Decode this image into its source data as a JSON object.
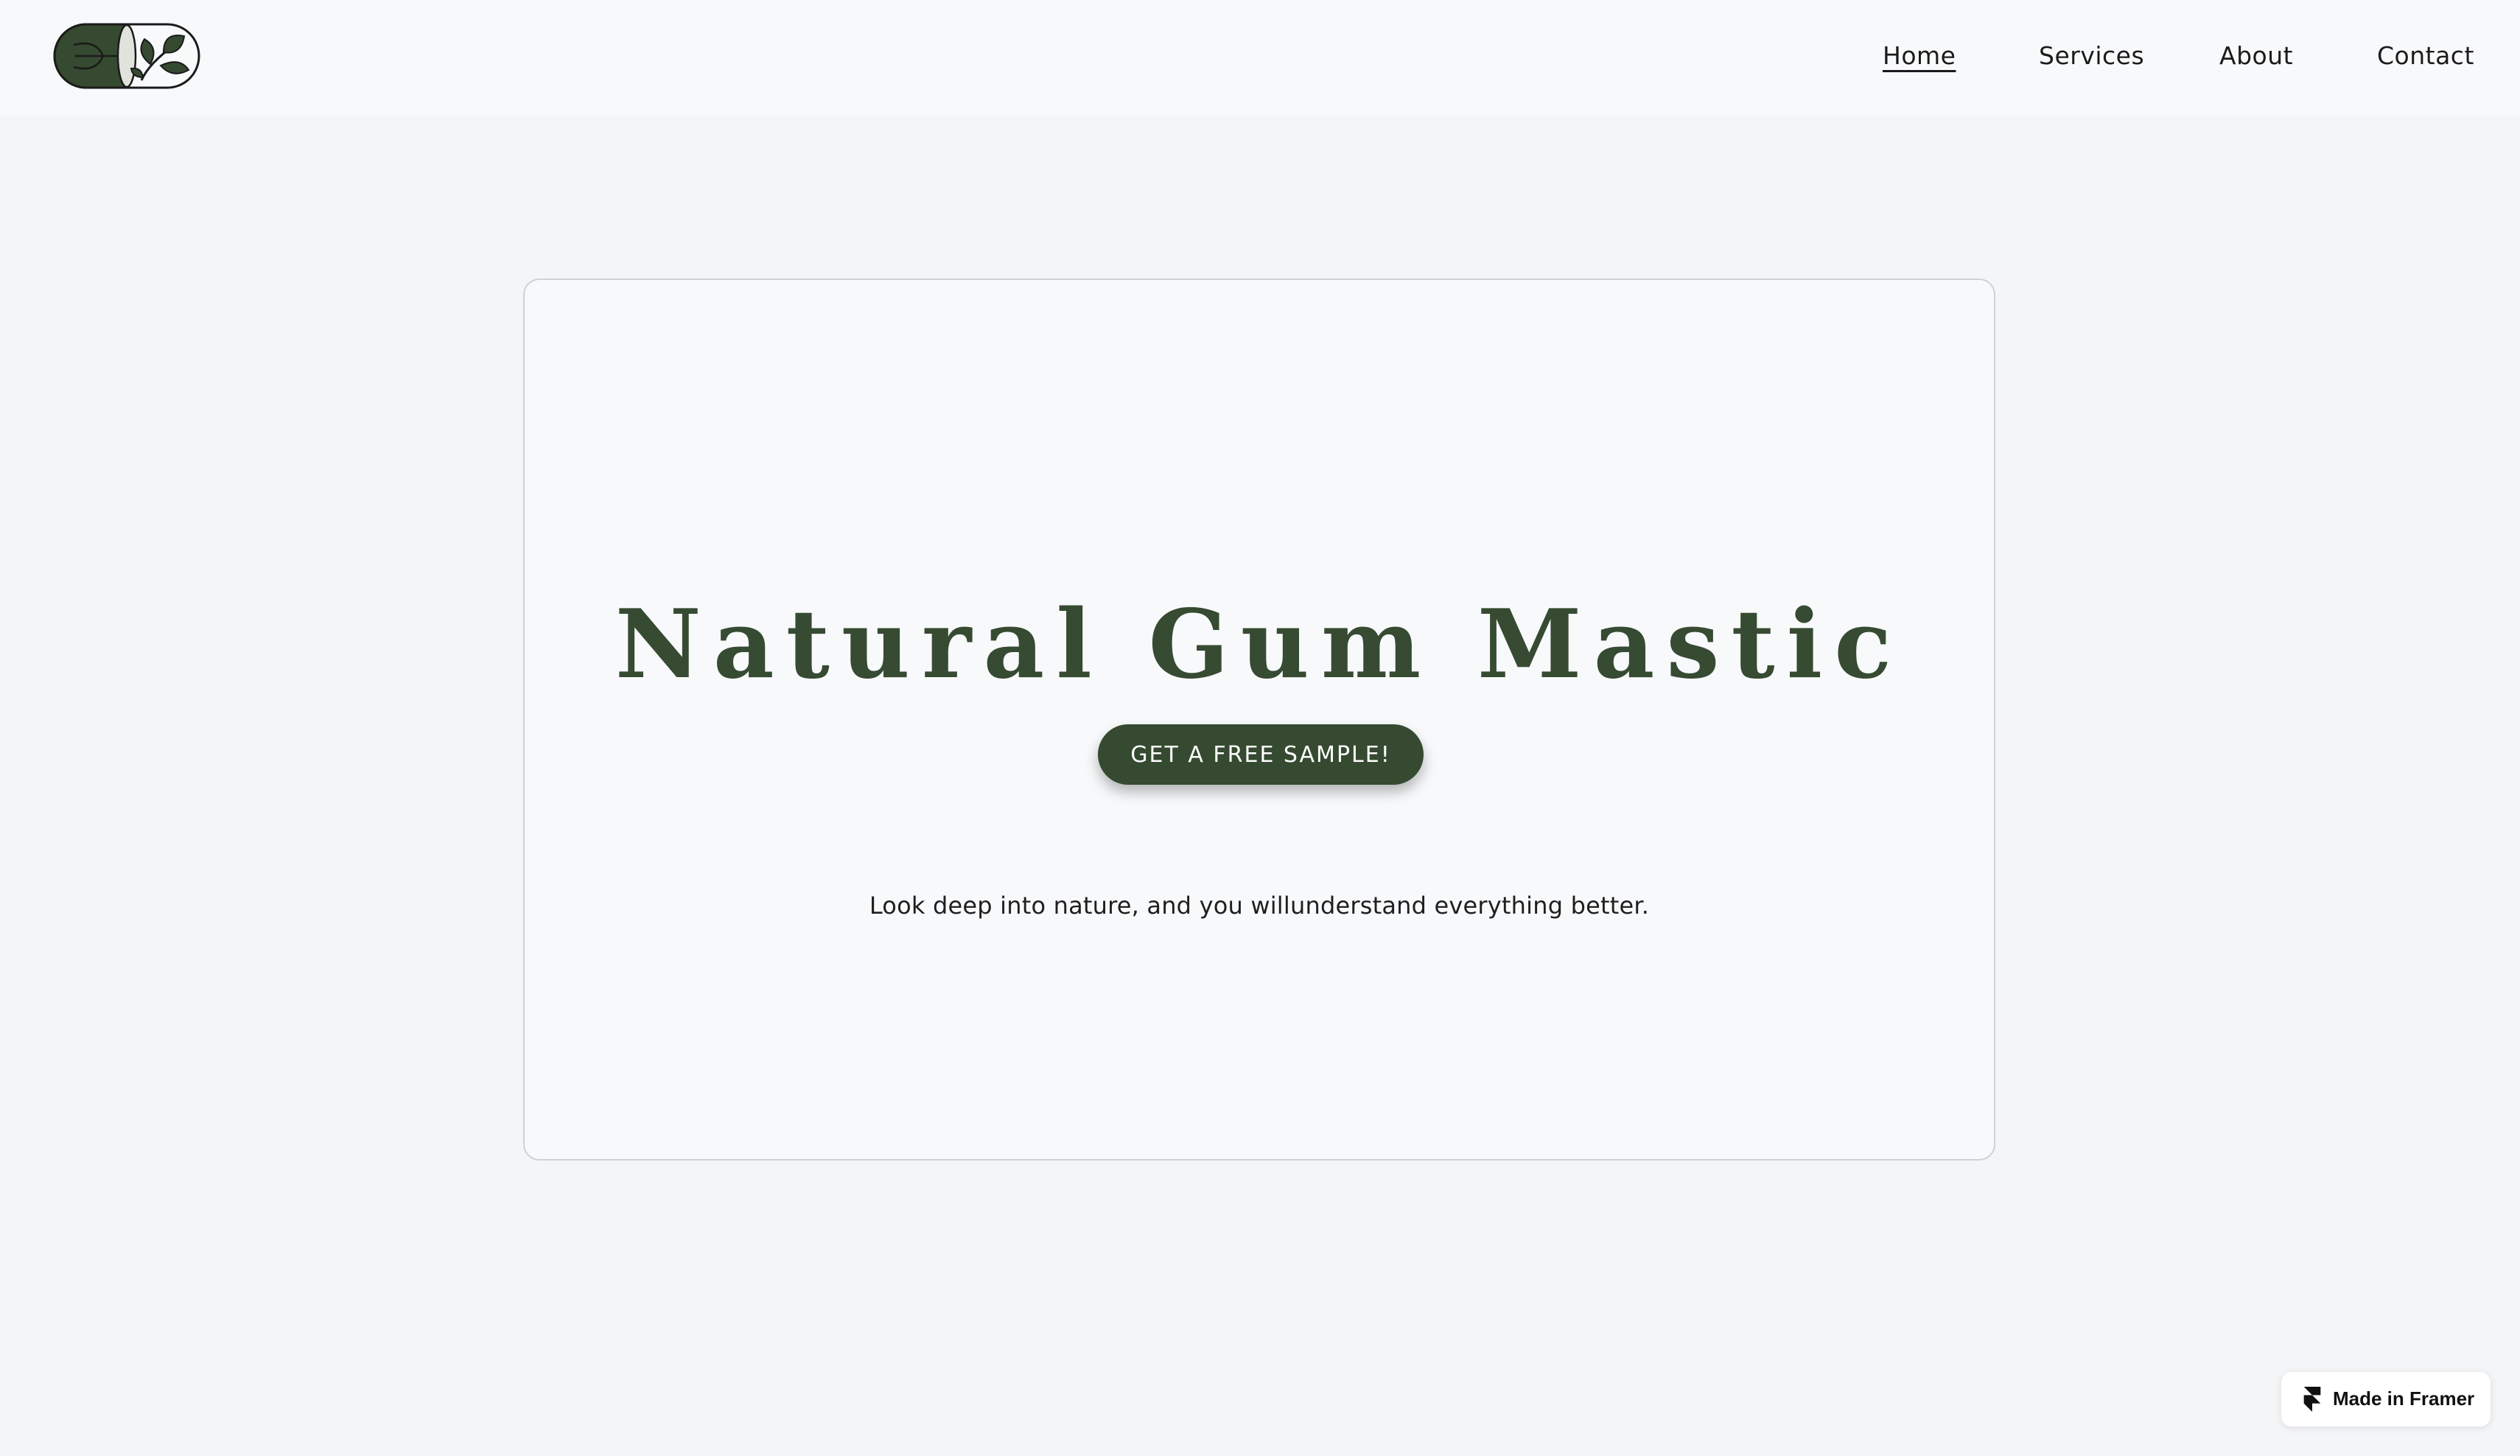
{
  "header": {
    "logo": {
      "icon": "capsule-leaf-logo",
      "colors": {
        "fill": "#354a30",
        "outline": "#1b1b1b",
        "light": "#dfe3dc"
      }
    },
    "nav": [
      {
        "label": "Home",
        "active": true
      },
      {
        "label": "Services",
        "active": false
      },
      {
        "label": "About",
        "active": false
      },
      {
        "label": "Contact",
        "active": false
      }
    ]
  },
  "hero": {
    "title": "Natural Gum Mastic",
    "cta_label": "GET A FREE SAMPLE!",
    "tagline": "Look deep into nature, and you willunderstand everything better."
  },
  "badge": {
    "label": "Made in Framer",
    "icon": "framer-icon"
  },
  "colors": {
    "accent": "#354a30",
    "title": "#364b32",
    "page_bg": "#f4f5f7",
    "card_bg": "#f8f9fb",
    "card_border": "#cfd1d5"
  }
}
